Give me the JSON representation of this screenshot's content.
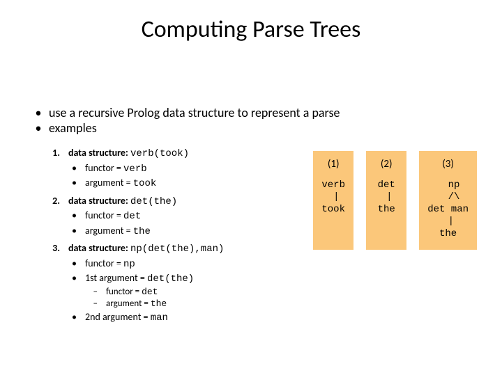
{
  "title": "Computing Parse Trees",
  "top_bullets": [
    "use a recursive Prolog data structure to represent a parse",
    "examples"
  ],
  "items": [
    {
      "num": "1.",
      "label": "data structure:",
      "code": "verb(took)",
      "subs": [
        {
          "label": "functor =",
          "code": "verb"
        },
        {
          "label": "argument =",
          "code": "took"
        }
      ]
    },
    {
      "num": "2.",
      "label": "data structure:",
      "code": "det(the)",
      "subs": [
        {
          "label": "functor =",
          "code": "det"
        },
        {
          "label": "argument =",
          "code": "the"
        }
      ]
    },
    {
      "num": "3.",
      "label": "data structure:",
      "code": "np(det(the),man)",
      "subs": [
        {
          "label": "functor =",
          "code": "np"
        },
        {
          "label": "1st argument =",
          "code": "det(the)",
          "subs2": [
            {
              "label": "functor =",
              "code": "det"
            },
            {
              "label": "argument =",
              "code": "the"
            }
          ]
        },
        {
          "label": "2nd argument =",
          "code": "man"
        }
      ]
    }
  ],
  "boxes": [
    {
      "head": "(1)",
      "body": "verb\n |\ntook"
    },
    {
      "head": "(2)",
      "body": "det\n |\nthe"
    },
    {
      "head": "(3)",
      "body": "  np\n  /\\\ndet man\n |\nthe"
    }
  ]
}
